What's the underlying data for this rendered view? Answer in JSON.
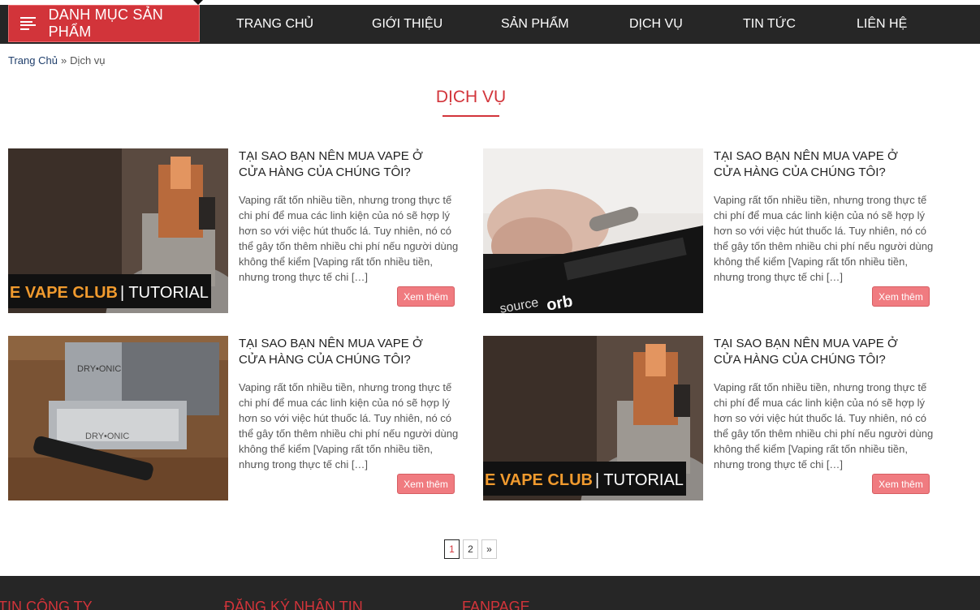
{
  "nav": {
    "category_button": "DANH MỤC SẢN PHẨM",
    "items": [
      "TRANG CHỦ",
      "GIỚI THIỆU",
      "SẢN PHẨM",
      "DỊCH VỤ",
      "TIN TỨC",
      "LIÊN HỆ"
    ]
  },
  "breadcrumb": {
    "home": "Trang Chủ",
    "separator": "»",
    "current": "Dịch vụ"
  },
  "page_title": "DỊCH VỤ",
  "posts": [
    {
      "title": "TẠI SAO BẠN NÊN MUA VAPE Ở CỬA HÀNG CỦA CHÚNG TÔI?",
      "excerpt": "Vaping rất tốn nhiều tiền, nhưng trong thực tế chi phí để mua các linh kiện của nó sẽ hợp lý hơn so với việc hút thuốc lá. Tuy nhiên, nó có thể gây tốn thêm nhiều chi phí nếu người dùng không thể kiểm [Vaping rất tốn nhiều tiền, nhưng trong thực tế chi […]",
      "more": "Xem thêm",
      "image_caption": "E VAPE CLUB | TUTORIAL"
    },
    {
      "title": "TẠI SAO BẠN NÊN MUA VAPE Ở CỬA HÀNG CỦA CHÚNG TÔI?",
      "excerpt": "Vaping rất tốn nhiều tiền, nhưng trong thực tế chi phí để mua các linh kiện của nó sẽ hợp lý hơn so với việc hút thuốc lá. Tuy nhiên, nó có thể gây tốn thêm nhiều chi phí nếu người dùng không thể kiểm [Vaping rất tốn nhiều tiền, nhưng trong thực tế chi […]",
      "more": "Xem thêm",
      "image_caption": "source orb"
    },
    {
      "title": "TẠI SAO BẠN NÊN MUA VAPE Ở CỬA HÀNG CỦA CHÚNG TÔI?",
      "excerpt": "Vaping rất tốn nhiều tiền, nhưng trong thực tế chi phí để mua các linh kiện của nó sẽ hợp lý hơn so với việc hút thuốc lá. Tuy nhiên, nó có thể gây tốn thêm nhiều chi phí nếu người dùng không thể kiểm [Vaping rất tốn nhiều tiền, nhưng trong thực tế chi […]",
      "more": "Xem thêm",
      "image_caption": "DRY•ONIC"
    },
    {
      "title": "TẠI SAO BẠN NÊN MUA VAPE Ở CỬA HÀNG CỦA CHÚNG TÔI?",
      "excerpt": "Vaping rất tốn nhiều tiền, nhưng trong thực tế chi phí để mua các linh kiện của nó sẽ hợp lý hơn so với việc hút thuốc lá. Tuy nhiên, nó có thể gây tốn thêm nhiều chi phí nếu người dùng không thể kiểm [Vaping rất tốn nhiều tiền, nhưng trong thực tế chi […]",
      "more": "Xem thêm",
      "image_caption": "E VAPE CLUB | TUTORIAL"
    }
  ],
  "pagination": {
    "pages": [
      "1",
      "2"
    ],
    "next": "»",
    "current": "1"
  },
  "footer": {
    "headings": [
      "TIN CÔNG TY",
      "ĐĂNG KÝ NHẬN TIN",
      "FANPAGE"
    ]
  },
  "colors": {
    "accent": "#d2343a",
    "nav_bg": "#262626",
    "button": "#f07b80"
  }
}
